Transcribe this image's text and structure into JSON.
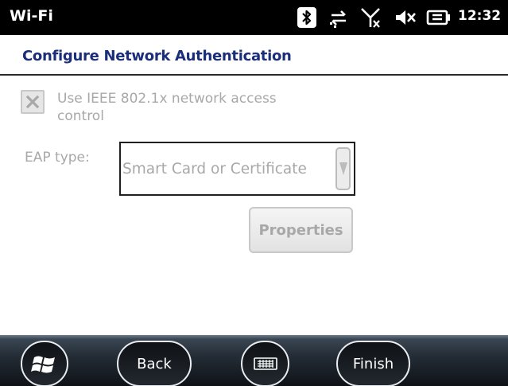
{
  "status_bar": {
    "app_title": "Wi-Fi",
    "time": "12:32",
    "icons": [
      "bluetooth-icon",
      "data-sync-icon",
      "no-signal-icon",
      "volume-muted-icon",
      "battery-charging-icon"
    ]
  },
  "page": {
    "heading": "Configure Network Authentication"
  },
  "checkbox": {
    "label": "Use IEEE 802.1x network access control",
    "checked": true,
    "enabled": false
  },
  "eap": {
    "label": "EAP type:",
    "selected": "Smart Card or Certificate",
    "enabled": false
  },
  "properties_button": {
    "label": "Properties",
    "enabled": false
  },
  "bottom_bar": {
    "back_label": "Back",
    "finish_label": "Finish",
    "icons": [
      "windows-start-icon",
      "keyboard-icon"
    ]
  },
  "colors": {
    "heading": "#1a2e7a",
    "disabled_text": "#a8a8a8",
    "status_bar_bg": "#000000"
  }
}
